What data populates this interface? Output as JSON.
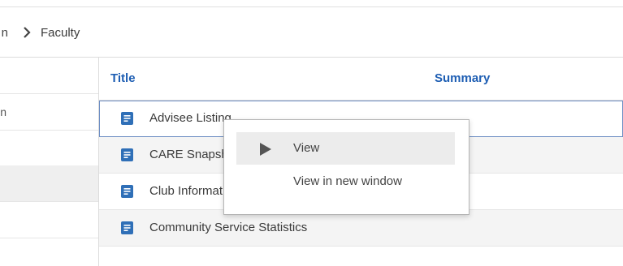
{
  "breadcrumb": {
    "previous": "n",
    "current": "Faculty"
  },
  "grid": {
    "columns": {
      "title": "Title",
      "summary": "Summary"
    },
    "rows": [
      {
        "title": "Advisee Listing",
        "focused": true
      },
      {
        "title": "CARE Snapshot"
      },
      {
        "title": "Club Information"
      },
      {
        "title": "Community Service Statistics"
      }
    ]
  },
  "left_column": {
    "fragment": "n"
  },
  "context_menu": {
    "items": [
      {
        "label": "View",
        "icon": "play-icon"
      },
      {
        "label": "View in new window"
      }
    ]
  },
  "colors": {
    "accent_header": "#1e5eb3",
    "report_icon": "#2f6fb7",
    "focus_outline": "#6f8fc4",
    "row_alt": "#f4f4f4"
  }
}
